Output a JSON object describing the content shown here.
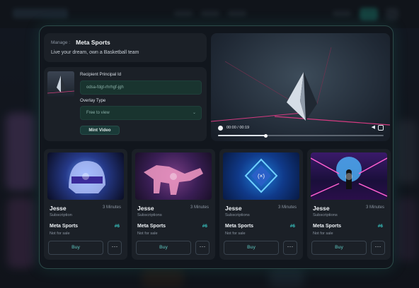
{
  "form": {
    "manage_label": "Manage :",
    "manage_title": "Meta Sports",
    "tagline": "Live your dream, own a Basketball team",
    "recipient_label": "Recipient Principal Id",
    "recipient_value": "odsa-fdgt-rhrhgf-jgh",
    "overlay_label": "Overlay Type",
    "overlay_value": "Free to view",
    "mint_label": "Mint Video"
  },
  "video": {
    "time": "00:00 / 00:19",
    "progress": 0.29
  },
  "cards": [
    {
      "name": "Jesse",
      "duration": "3 Minutes",
      "type": "Subscription",
      "collection": "Meta Sports",
      "number": "#6",
      "status": "Not for sale",
      "buy": "Buy",
      "more": "···",
      "image_icon": "helmet-image"
    },
    {
      "name": "Jesse",
      "duration": "3 Minutes",
      "type": "Subscriptions",
      "collection": "Meta Sports",
      "number": "#6",
      "status": "Not for sale",
      "buy": "Buy",
      "more": "···",
      "image_icon": "dinosaur-image"
    },
    {
      "name": "Jesse",
      "duration": "3 Minutes",
      "type": "Subscriptions",
      "collection": "Meta Sports",
      "number": "#6",
      "status": "Not for sale",
      "buy": "Buy",
      "more": "···",
      "image_icon": "token-logo-image"
    },
    {
      "name": "Jesse",
      "duration": "3 Minutes",
      "type": "Subscriptions",
      "collection": "Meta Sports",
      "number": "#6",
      "status": "Not for sale",
      "buy": "Buy",
      "more": "···",
      "image_icon": "neon-corridor-image"
    }
  ],
  "colors": {
    "accent": "#38c7c3",
    "modal_border": "#2c4a48",
    "field_bg": "#19342f"
  }
}
